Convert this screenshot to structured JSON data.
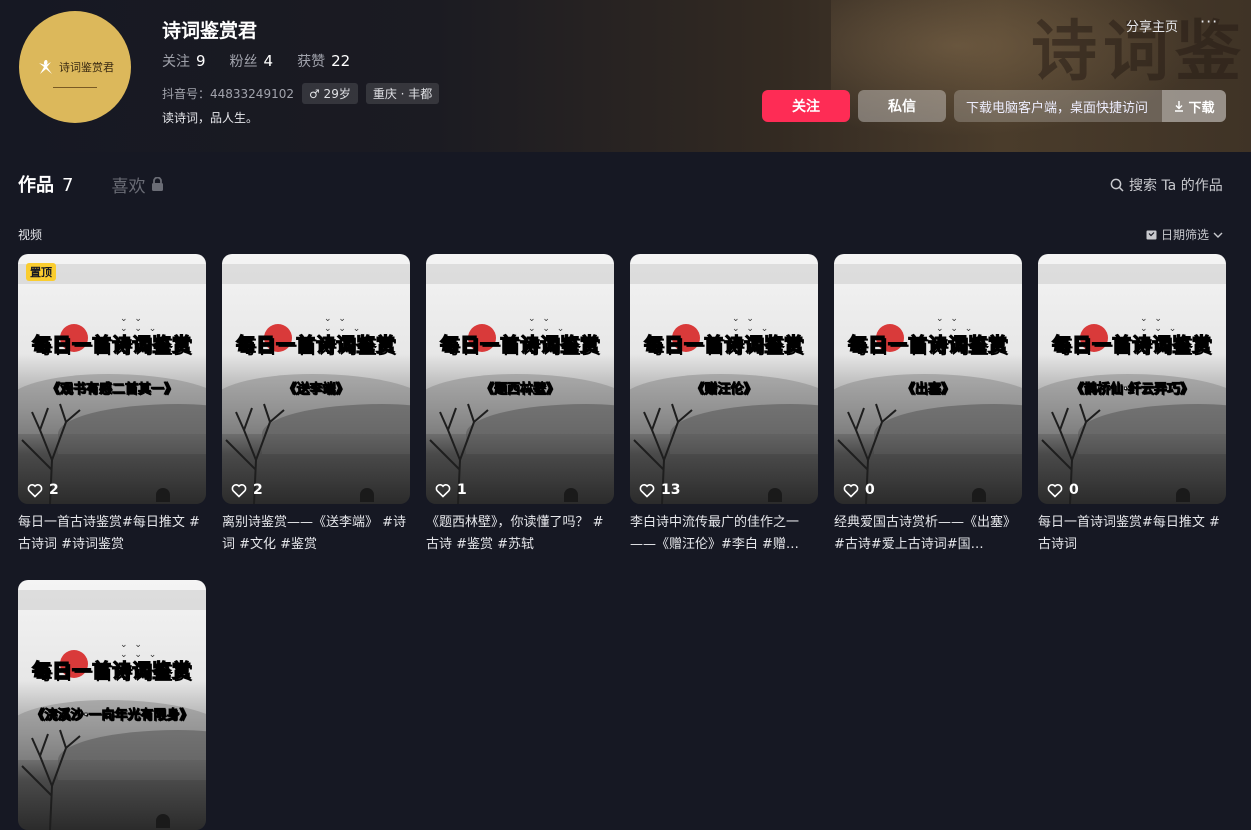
{
  "profile": {
    "username": "诗词鉴赏君",
    "avatar_text": "诗词鉴赏君",
    "following_label": "关注",
    "following_count": "9",
    "followers_label": "粉丝",
    "followers_count": "4",
    "likes_label": "获赞",
    "likes_count": "22",
    "douyin_id": "抖音号：44833249102",
    "age": "♂ 29岁",
    "location": "重庆 · 丰都",
    "bio": "读诗词，品人生。"
  },
  "header": {
    "share_label": "分享主页",
    "more_label": "···",
    "follow_label": "关注",
    "message_label": "私信",
    "download_text": "下载电脑客户端，桌面快捷访问",
    "download_btn": "下载",
    "watermark": "诗词鉴"
  },
  "tabs": {
    "works_label": "作品",
    "works_count": "7",
    "likes_label": "喜欢"
  },
  "search": {
    "label": "搜索 Ta 的作品"
  },
  "section": {
    "videos_label": "视频",
    "date_filter": "日期筛选"
  },
  "videos": [
    {
      "title_top": "每日一首诗词鉴赏",
      "subtitle": "《观书有感二首其一》",
      "likes": "2",
      "pinned": "置顶",
      "desc": "每日一首古诗鉴赏#每日推文 #古诗词 #诗词鉴赏"
    },
    {
      "title_top": "每日一首诗词鉴赏",
      "subtitle": "《送李端》",
      "likes": "2",
      "desc": "离别诗鉴赏——《送李端》 #诗词 #文化 #鉴赏"
    },
    {
      "title_top": "每日一首诗词鉴赏",
      "subtitle": "《题西林壁》",
      "likes": "1",
      "desc": "《题西林壁》，你读懂了吗？ #古诗 #鉴赏 #苏轼"
    },
    {
      "title_top": "每日一首诗词鉴赏",
      "subtitle": "《赠汪伦》",
      "likes": "13",
      "desc": "李白诗中流传最广的佳作之一——《赠汪伦》#李白 #赠…"
    },
    {
      "title_top": "每日一首诗词鉴赏",
      "subtitle": "《出塞》",
      "likes": "0",
      "desc": "经典爱国古诗赏析——《出塞》#古诗#爱上古诗词#国…"
    },
    {
      "title_top": "每日一首诗词鉴赏",
      "subtitle": "《鹊桥仙·纤云弄巧》",
      "likes": "0",
      "desc": "每日一首诗词鉴赏#每日推文 #古诗词"
    },
    {
      "title_top": "每日一首诗词鉴赏",
      "subtitle": "《浣溪沙·一向年光有限身》",
      "likes": "",
      "desc": ""
    }
  ],
  "colors": {
    "accent": "#fe2c55",
    "background": "#161823",
    "pin": "#facd2f"
  }
}
